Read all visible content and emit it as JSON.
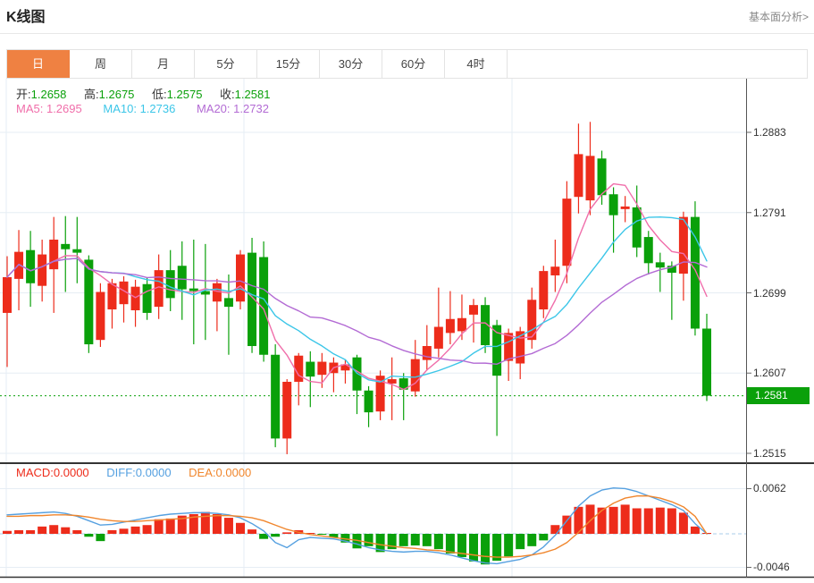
{
  "header": {
    "title": "K线图",
    "link_label": "基本面分析>"
  },
  "tabs": {
    "items": [
      "日",
      "周",
      "月",
      "5分",
      "15分",
      "30分",
      "60分",
      "4时"
    ],
    "active": "日"
  },
  "legend_ohlc": {
    "open_label": "开:",
    "open": "1.2658",
    "high_label": "高:",
    "high": "1.2675",
    "low_label": "低:",
    "low": "1.2575",
    "close_label": "收:",
    "close": "1.2581"
  },
  "legend_ma": {
    "ma5_label": "MA5:",
    "ma5": "1.2695",
    "ma10_label": "MA10:",
    "ma10": "1.2736",
    "ma20_label": "MA20:",
    "ma20": "1.2732"
  },
  "legend_macd": {
    "macd_label": "MACD:",
    "macd": "0.0000",
    "diff_label": "DIFF:",
    "diff": "0.0000",
    "dea_label": "DEA:",
    "dea": "0.0000"
  },
  "colors": {
    "up": "#ed2c1b",
    "down": "#0aa00a",
    "ma5": "#f06eaa",
    "ma10": "#3cc6e8",
    "ma20": "#b36bd4",
    "diff": "#55a0e0",
    "dea": "#f0862d",
    "tab_active": "#ef8142",
    "grid": "#e6edf4",
    "zero_dash": "#a9cdea",
    "border_dark": "#333333",
    "axis_tick": "#666666"
  },
  "chart_data": {
    "type": "candlestick",
    "panels": [
      "price",
      "macd"
    ],
    "y_axis": {
      "ticks": [
        "1.2883",
        "1.2791",
        "1.2699",
        "1.2607",
        "1.2515"
      ]
    },
    "current_price": "1.2581",
    "ma_periods": [
      5,
      10,
      20
    ],
    "candles": [
      [
        1.2676,
        1.2741,
        1.2614,
        1.2717
      ],
      [
        1.2715,
        1.2771,
        1.2679,
        1.2746
      ],
      [
        1.2748,
        1.277,
        1.2683,
        1.271
      ],
      [
        1.2707,
        1.276,
        1.2689,
        1.2743
      ],
      [
        1.2726,
        1.2786,
        1.2676,
        1.276
      ],
      [
        1.2755,
        1.2787,
        1.27,
        1.2749
      ],
      [
        1.2749,
        1.2786,
        1.271,
        1.2745
      ],
      [
        1.2737,
        1.2742,
        1.263,
        1.264
      ],
      [
        1.2645,
        1.271,
        1.2637,
        1.27
      ],
      [
        1.268,
        1.2715,
        1.2658,
        1.271
      ],
      [
        1.2686,
        1.2718,
        1.2665,
        1.2712
      ],
      [
        1.2679,
        1.2714,
        1.266,
        1.2706
      ],
      [
        1.2709,
        1.2716,
        1.2668,
        1.2676
      ],
      [
        1.2683,
        1.2743,
        1.2669,
        1.2725
      ],
      [
        1.2725,
        1.2748,
        1.2678,
        1.2693
      ],
      [
        1.273,
        1.2758,
        1.2668,
        1.2703
      ],
      [
        1.2704,
        1.276,
        1.264,
        1.2701
      ],
      [
        1.2701,
        1.2755,
        1.2645,
        1.2697
      ],
      [
        1.2689,
        1.2715,
        1.2655,
        1.271
      ],
      [
        1.2693,
        1.272,
        1.2628,
        1.2683
      ],
      [
        1.2689,
        1.2748,
        1.268,
        1.2743
      ],
      [
        1.2745,
        1.2762,
        1.263,
        1.2638
      ],
      [
        1.274,
        1.2758,
        1.262,
        1.2628
      ],
      [
        1.2628,
        1.264,
        1.2522,
        1.2532
      ],
      [
        1.2532,
        1.26,
        1.2514,
        1.2597
      ],
      [
        1.2597,
        1.263,
        1.257,
        1.2627
      ],
      [
        1.262,
        1.2632,
        1.2568,
        1.2603
      ],
      [
        1.2605,
        1.263,
        1.259,
        1.262
      ],
      [
        1.2607,
        1.2625,
        1.2585,
        1.2619
      ],
      [
        1.261,
        1.2622,
        1.2595,
        1.2617
      ],
      [
        1.2625,
        1.2628,
        1.256,
        1.2587
      ],
      [
        1.2587,
        1.2592,
        1.2545,
        1.2562
      ],
      [
        1.2563,
        1.261,
        1.2553,
        1.2604
      ],
      [
        1.2595,
        1.2625,
        1.2553,
        1.26
      ],
      [
        1.2601,
        1.2607,
        1.2553,
        1.2588
      ],
      [
        1.2586,
        1.2645,
        1.258,
        1.2623
      ],
      [
        1.2622,
        1.2662,
        1.261,
        1.2638
      ],
      [
        1.2635,
        1.2705,
        1.2625,
        1.266
      ],
      [
        1.2653,
        1.2701,
        1.264,
        1.2669
      ],
      [
        1.2655,
        1.2697,
        1.2645,
        1.267
      ],
      [
        1.2674,
        1.2692,
        1.2642,
        1.2685
      ],
      [
        1.2685,
        1.2694,
        1.263,
        1.2639
      ],
      [
        1.2662,
        1.2668,
        1.2535,
        1.2604
      ],
      [
        1.2621,
        1.2658,
        1.2598,
        1.2653
      ],
      [
        1.2618,
        1.266,
        1.26,
        1.2655
      ],
      [
        1.2645,
        1.2705,
        1.2635,
        1.2691
      ],
      [
        1.268,
        1.273,
        1.267,
        1.2724
      ],
      [
        1.2719,
        1.276,
        1.27,
        1.2729
      ],
      [
        1.273,
        1.2827,
        1.271,
        1.2807
      ],
      [
        1.2809,
        1.2893,
        1.279,
        1.2858
      ],
      [
        1.2805,
        1.2895,
        1.2788,
        1.2856
      ],
      [
        1.2853,
        1.2862,
        1.28,
        1.2811
      ],
      [
        1.2812,
        1.282,
        1.2745,
        1.2788
      ],
      [
        1.2795,
        1.281,
        1.278,
        1.2798
      ],
      [
        1.2797,
        1.2822,
        1.274,
        1.2751
      ],
      [
        1.2763,
        1.277,
        1.272,
        1.2733
      ],
      [
        1.2734,
        1.2745,
        1.27,
        1.2728
      ],
      [
        1.273,
        1.2735,
        1.2668,
        1.2722
      ],
      [
        1.2721,
        1.2792,
        1.269,
        1.2786
      ],
      [
        1.2786,
        1.2804,
        1.265,
        1.2658
      ],
      [
        1.2658,
        1.2675,
        1.2575,
        1.2581
      ]
    ],
    "macd": {
      "y_ticks": [
        "0.0062",
        "-0.0046"
      ],
      "histogram": [
        0.0004,
        0.0005,
        0.0005,
        0.001,
        0.0012,
        0.0009,
        0.0005,
        -0.0004,
        -0.001,
        0.0005,
        0.0007,
        0.001,
        0.0012,
        0.002,
        0.0021,
        0.0025,
        0.0027,
        0.003,
        0.0027,
        0.0022,
        0.0015,
        0.0006,
        -0.0007,
        -0.0004,
        0.0002,
        0.0005,
        0.0001,
        -0.0001,
        -0.0005,
        -0.0012,
        -0.002,
        -0.0017,
        -0.0025,
        -0.0021,
        -0.0017,
        -0.0016,
        -0.0017,
        -0.0021,
        -0.0027,
        -0.0032,
        -0.0038,
        -0.0042,
        -0.0037,
        -0.0031,
        -0.0021,
        -0.0017,
        -0.0009,
        0.0012,
        0.0025,
        0.0037,
        0.004,
        0.0036,
        0.0037,
        0.004,
        0.0035,
        0.0035,
        0.0036,
        0.0035,
        0.0029,
        0.001,
        0.0
      ],
      "diff": [
        0.0026,
        0.0027,
        0.0028,
        0.0029,
        0.003,
        0.0028,
        0.0024,
        0.0018,
        0.0012,
        0.0013,
        0.0016,
        0.0019,
        0.0022,
        0.0025,
        0.0027,
        0.0028,
        0.0029,
        0.0029,
        0.0028,
        0.0026,
        0.0022,
        0.0014,
        0.0004,
        -0.0012,
        -0.0019,
        -0.0008,
        -0.0005,
        -0.0006,
        -0.0007,
        -0.001,
        -0.0014,
        -0.0019,
        -0.0022,
        -0.0024,
        -0.0025,
        -0.0024,
        -0.0024,
        -0.0026,
        -0.0029,
        -0.0033,
        -0.0037,
        -0.004,
        -0.0041,
        -0.0038,
        -0.0035,
        -0.0029,
        -0.0018,
        -0.0002,
        0.0018,
        0.0038,
        0.0052,
        0.006,
        0.0063,
        0.0062,
        0.0058,
        0.0052,
        0.0046,
        0.004,
        0.0032,
        0.0014,
        0.0
      ],
      "dea": [
        0.0024,
        0.0024,
        0.0025,
        0.0025,
        0.0026,
        0.0026,
        0.0025,
        0.0023,
        0.002,
        0.0018,
        0.0017,
        0.0017,
        0.0018,
        0.0019,
        0.002,
        0.0021,
        0.0023,
        0.0024,
        0.0025,
        0.0025,
        0.0024,
        0.0022,
        0.0018,
        0.0012,
        0.0006,
        0.0002,
        -0.0001,
        -0.0003,
        -0.0005,
        -0.0007,
        -0.0009,
        -0.0012,
        -0.0015,
        -0.0017,
        -0.0019,
        -0.002,
        -0.0022,
        -0.0023,
        -0.0025,
        -0.0027,
        -0.0029,
        -0.0031,
        -0.0032,
        -0.0032,
        -0.0031,
        -0.0029,
        -0.0026,
        -0.0021,
        -0.0012,
        0.0002,
        0.0018,
        0.0032,
        0.0042,
        0.0049,
        0.0052,
        0.0052,
        0.0049,
        0.0044,
        0.0037,
        0.0024,
        0.0
      ]
    }
  }
}
